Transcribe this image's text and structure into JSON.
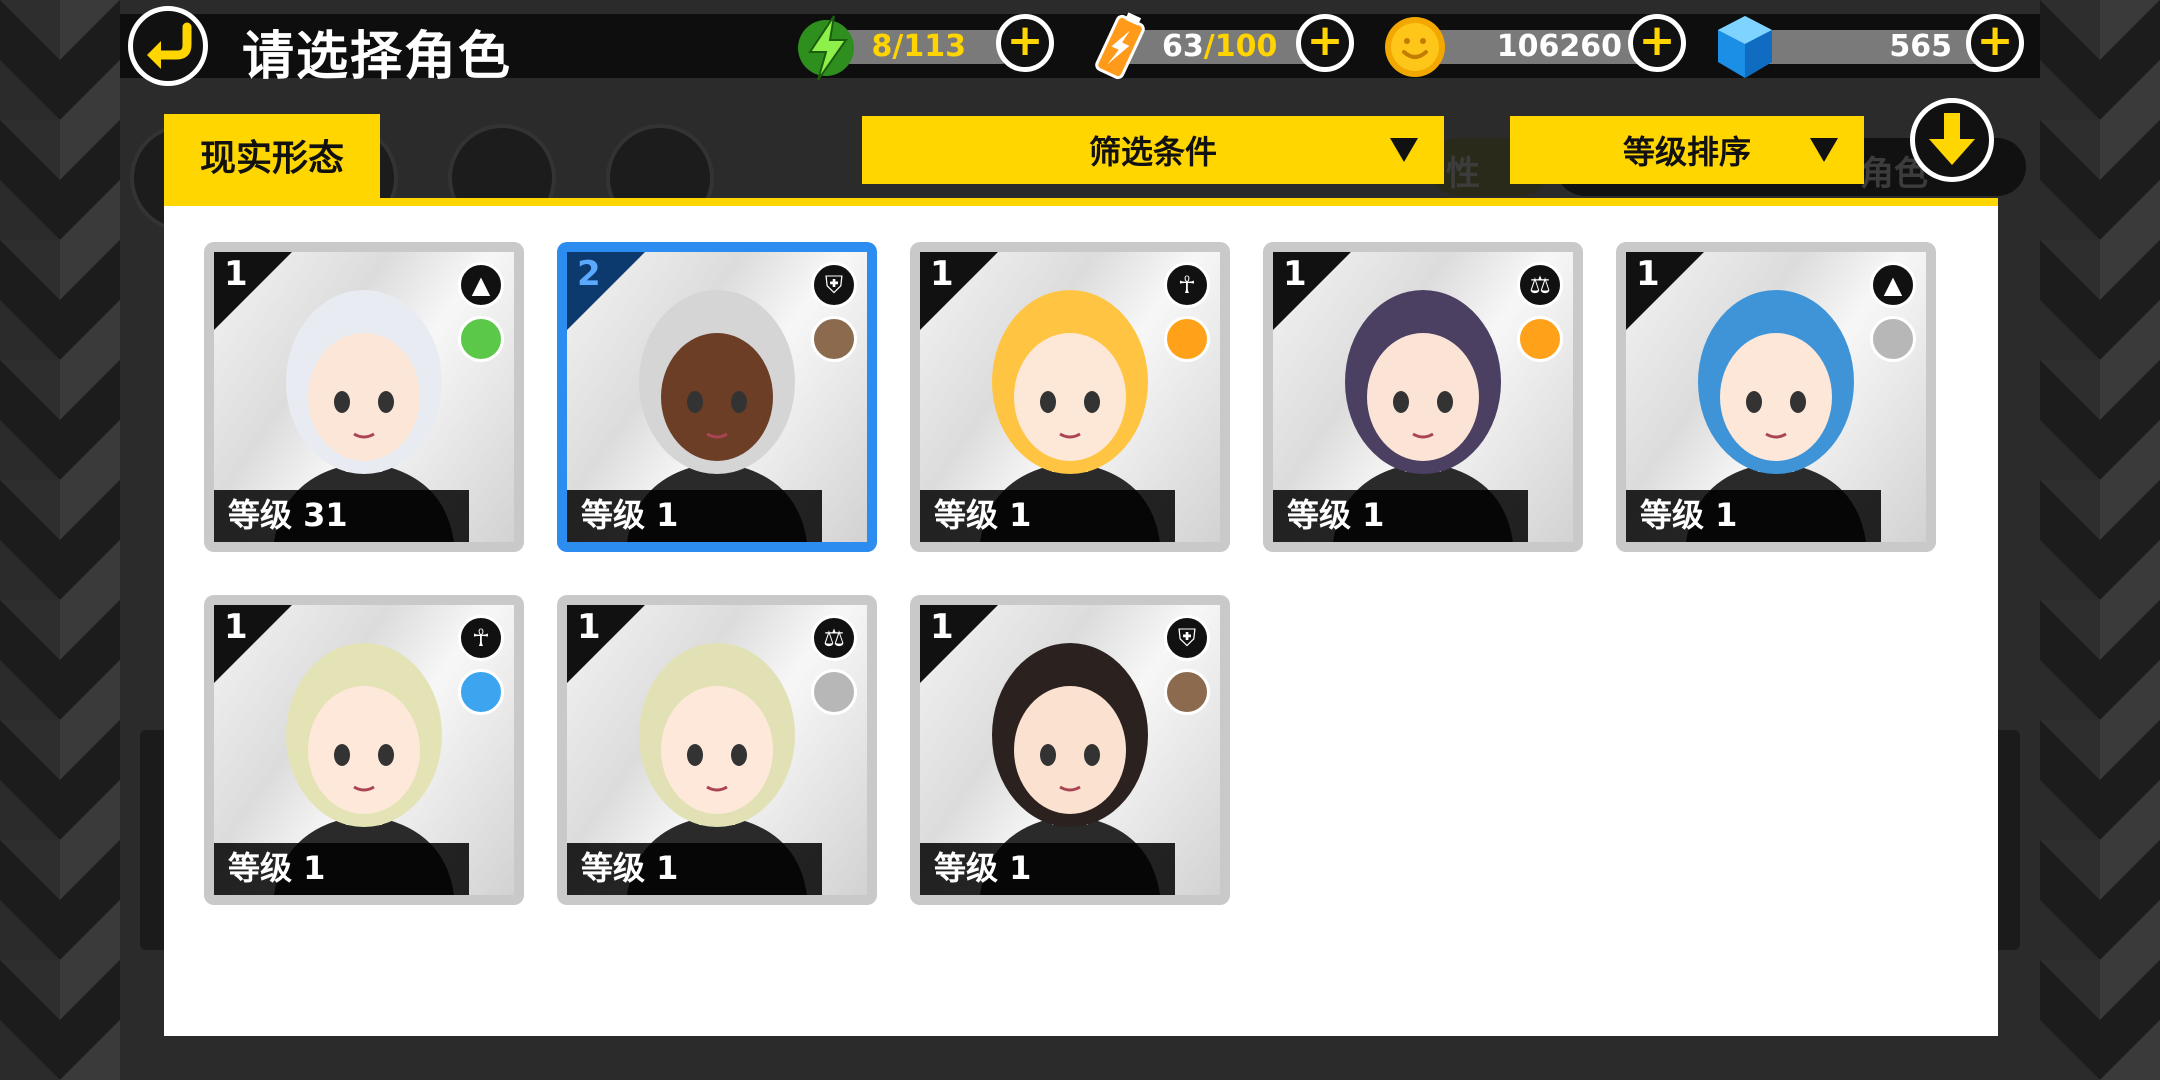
{
  "header": {
    "title": "请选择角色",
    "resources": {
      "energy": {
        "current": "8",
        "max": "/113"
      },
      "battery": {
        "current": "63",
        "max": "/100"
      },
      "coins": {
        "value": "106260"
      },
      "gems": {
        "value": "565"
      }
    },
    "plus": "+"
  },
  "tabs": {
    "active": "现实形态",
    "ghost_text_1": "性",
    "ghost_text_2": "角色"
  },
  "filters": {
    "filter_label": "筛选条件",
    "sort_label": "等级排序"
  },
  "cards": [
    {
      "rank": "1",
      "label": "等级 31",
      "class_icon": "triangle-icon",
      "class_glyph": "▲",
      "element": "leaf-icon",
      "element_color": "#5cc84a",
      "hair": "#e8ecf2",
      "skin": "#fbe6d8"
    },
    {
      "rank": "2",
      "label": "等级 1",
      "class_icon": "shield-icon",
      "class_glyph": "⛨",
      "element": "rock-icon",
      "element_color": "#8b6a4e",
      "hair": "#d5d5d5",
      "skin": "#6b3e25"
    },
    {
      "rank": "1",
      "label": "等级 1",
      "class_icon": "ankh-icon",
      "class_glyph": "☥",
      "element": "lightning-icon",
      "element_color": "#ffa21a",
      "hair": "#ffc542",
      "skin": "#fde7d6"
    },
    {
      "rank": "1",
      "label": "等级 1",
      "class_icon": "scales-icon",
      "class_glyph": "⚖",
      "element": "lightning-icon",
      "element_color": "#ffa21a",
      "hair": "#4b3f62",
      "skin": "#fbe4d6"
    },
    {
      "rank": "1",
      "label": "等级 1",
      "class_icon": "triangle-icon",
      "class_glyph": "▲",
      "element": "wind-icon",
      "element_color": "#b7b7b7",
      "hair": "#3f94d8",
      "skin": "#fde7d9"
    },
    {
      "rank": "1",
      "label": "等级 1",
      "class_icon": "ankh-icon",
      "class_glyph": "☥",
      "element": "water-icon",
      "element_color": "#3da5f0",
      "hair": "#e4e3b6",
      "skin": "#fde8d9"
    },
    {
      "rank": "1",
      "label": "等级 1",
      "class_icon": "scales-icon",
      "class_glyph": "⚖",
      "element": "wind-icon",
      "element_color": "#b7b7b7",
      "hair": "#e2e1b5",
      "skin": "#fde8d9"
    },
    {
      "rank": "1",
      "label": "等级 1",
      "class_icon": "shield-icon",
      "class_glyph": "⛨",
      "element": "rock-icon",
      "element_color": "#8b6a4e",
      "hair": "#2b2220",
      "skin": "#fbe2d0"
    }
  ]
}
